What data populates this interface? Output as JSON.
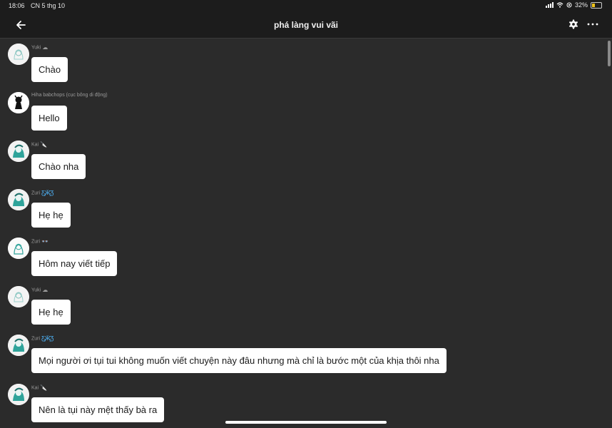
{
  "status_bar": {
    "time": "18:06",
    "date": "CN 5 thg 10",
    "battery": "32%",
    "battery_level": 0.32
  },
  "header": {
    "title": "phá làng vui vãi"
  },
  "messages": [
    {
      "author": "Yuki",
      "decoration_icon": "cloud-icon",
      "text": "Chào",
      "avatar": "avatar-sketch"
    },
    {
      "author": "Hiha babchops (cục bông di động)",
      "decoration_icon": "",
      "text": "Hello",
      "avatar": "avatar-dark-figure"
    },
    {
      "author": "Kai",
      "decoration_icon": "knife-icon",
      "text": "Chào nha",
      "avatar": "avatar-teal"
    },
    {
      "author": "Zuri",
      "decoration_icon": "butterfly-icon",
      "text": "Hẹ hẹ",
      "avatar": "avatar-teal"
    },
    {
      "author": "Zuri",
      "decoration_icon": "glasses-icon",
      "text": "Hôm nay viết tiếp",
      "avatar": "avatar-sketch-teal"
    },
    {
      "author": "Yuki",
      "decoration_icon": "cloud-icon",
      "text": "Hẹ hẹ",
      "avatar": "avatar-sketch"
    },
    {
      "author": "Zuri",
      "decoration_icon": "butterfly-icon",
      "text": "Mọi người ơi tụi tui không muốn viết chuyện này đâu nhưng mà chỉ là bước một của khịa thôi nha",
      "avatar": "avatar-teal"
    },
    {
      "author": "Kai",
      "decoration_icon": "knife-icon",
      "text": "Nên là tụi này mệt thấy bà ra",
      "avatar": "avatar-teal"
    }
  ],
  "colors": {
    "background": "#2b2b2b",
    "bar": "#1c1c1c",
    "bubble": "#ffffff",
    "accent_teal": "#2fa39a",
    "butterfly": "#4fb8ff"
  }
}
